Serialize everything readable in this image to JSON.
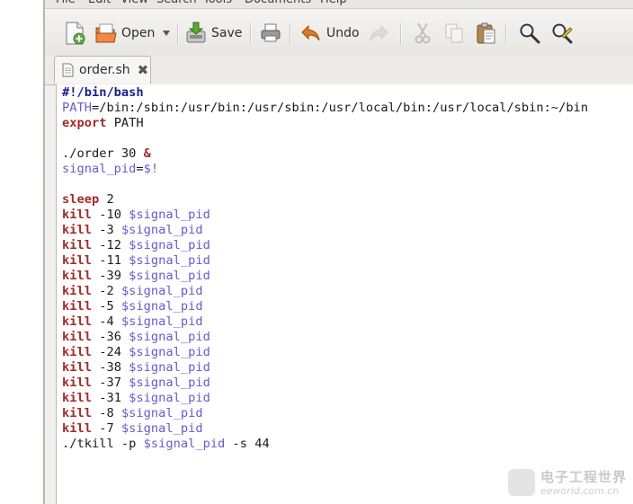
{
  "menu": {
    "items": [
      "File",
      "Edit",
      "View",
      "Search",
      "Tools",
      "Documents",
      "Help"
    ]
  },
  "toolbar": {
    "open_label": "Open",
    "save_label": "Save",
    "undo_label": "Undo"
  },
  "tab": {
    "filename": "order.sh"
  },
  "editor": {
    "lines": [
      [
        {
          "t": "#!/bin/bash",
          "c": "sb"
        }
      ],
      [
        {
          "t": "PATH",
          "c": "v"
        },
        {
          "t": "=/bin:/sbin:/usr/bin:/usr/sbin:/usr/local/bin:/usr/local/sbin:~/bin",
          "c": ""
        }
      ],
      [
        {
          "t": "export",
          "c": "k"
        },
        {
          "t": " PATH",
          "c": ""
        }
      ],
      [],
      [
        {
          "t": "./order 30 ",
          "c": ""
        },
        {
          "t": "&",
          "c": "k"
        }
      ],
      [
        {
          "t": "signal_pid",
          "c": "v"
        },
        {
          "t": "=",
          "c": ""
        },
        {
          "t": "$!",
          "c": "v"
        }
      ],
      [],
      [
        {
          "t": "sleep",
          "c": "k"
        },
        {
          "t": " 2",
          "c": ""
        }
      ],
      [
        {
          "t": "kill",
          "c": "k"
        },
        {
          "t": " -10 ",
          "c": ""
        },
        {
          "t": "$signal_pid",
          "c": "v"
        }
      ],
      [
        {
          "t": "kill",
          "c": "k"
        },
        {
          "t": " -3 ",
          "c": ""
        },
        {
          "t": "$signal_pid",
          "c": "v"
        }
      ],
      [
        {
          "t": "kill",
          "c": "k"
        },
        {
          "t": " -12 ",
          "c": ""
        },
        {
          "t": "$signal_pid",
          "c": "v"
        }
      ],
      [
        {
          "t": "kill",
          "c": "k"
        },
        {
          "t": " -11 ",
          "c": ""
        },
        {
          "t": "$signal_pid",
          "c": "v"
        }
      ],
      [
        {
          "t": "kill",
          "c": "k"
        },
        {
          "t": " -39 ",
          "c": ""
        },
        {
          "t": "$signal_pid",
          "c": "v"
        }
      ],
      [
        {
          "t": "kill",
          "c": "k"
        },
        {
          "t": " -2 ",
          "c": ""
        },
        {
          "t": "$signal_pid",
          "c": "v"
        }
      ],
      [
        {
          "t": "kill",
          "c": "k"
        },
        {
          "t": " -5 ",
          "c": ""
        },
        {
          "t": "$signal_pid",
          "c": "v"
        }
      ],
      [
        {
          "t": "kill",
          "c": "k"
        },
        {
          "t": " -4 ",
          "c": ""
        },
        {
          "t": "$signal_pid",
          "c": "v"
        }
      ],
      [
        {
          "t": "kill",
          "c": "k"
        },
        {
          "t": " -36 ",
          "c": ""
        },
        {
          "t": "$signal_pid",
          "c": "v"
        }
      ],
      [
        {
          "t": "kill",
          "c": "k"
        },
        {
          "t": " -24 ",
          "c": ""
        },
        {
          "t": "$signal_pid",
          "c": "v"
        }
      ],
      [
        {
          "t": "kill",
          "c": "k"
        },
        {
          "t": " -38 ",
          "c": ""
        },
        {
          "t": "$signal_pid",
          "c": "v"
        }
      ],
      [
        {
          "t": "kill",
          "c": "k"
        },
        {
          "t": " -37 ",
          "c": ""
        },
        {
          "t": "$signal_pid",
          "c": "v"
        }
      ],
      [
        {
          "t": "kill",
          "c": "k"
        },
        {
          "t": " -31 ",
          "c": ""
        },
        {
          "t": "$signal_pid",
          "c": "v"
        }
      ],
      [
        {
          "t": "kill",
          "c": "k"
        },
        {
          "t": " -8 ",
          "c": ""
        },
        {
          "t": "$signal_pid",
          "c": "v"
        }
      ],
      [
        {
          "t": "kill",
          "c": "k"
        },
        {
          "t": " -7 ",
          "c": ""
        },
        {
          "t": "$signal_pid",
          "c": "v"
        }
      ],
      [
        {
          "t": "./tkill -p ",
          "c": ""
        },
        {
          "t": "$signal_pid",
          "c": "v"
        },
        {
          "t": " -s 44",
          "c": ""
        }
      ]
    ]
  },
  "watermark": {
    "cn": "电子工程世界",
    "en": "eeworld.com.cn"
  },
  "colors": {
    "keyword": "#a52a2a",
    "variable": "#6a5acd",
    "shebang": "#1b1b8c"
  }
}
